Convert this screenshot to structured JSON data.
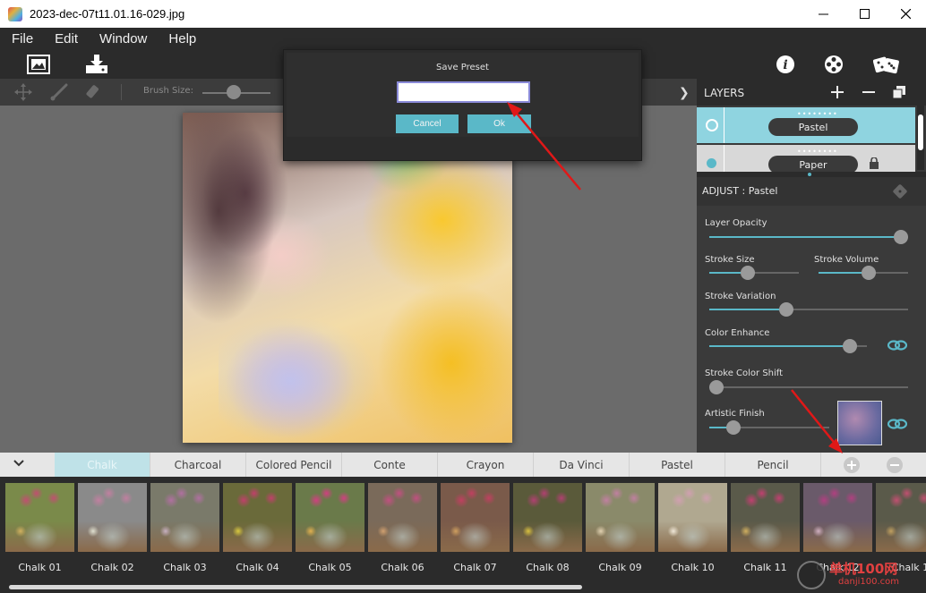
{
  "window": {
    "title": "2023-dec-07t11.01.16-029.jpg"
  },
  "menu": [
    "File",
    "Edit",
    "Window",
    "Help"
  ],
  "subtoolbar": {
    "brush_label": "Brush Size:",
    "brush_size": 0.45
  },
  "dialog": {
    "title": "Save Preset",
    "input_value": "",
    "cancel_label": "Cancel",
    "ok_label": "Ok"
  },
  "layers": {
    "title": "LAYERS",
    "items": [
      {
        "name": "Pastel",
        "selected": true
      },
      {
        "name": "Paper",
        "selected": false
      }
    ]
  },
  "adjust": {
    "title": "ADJUST : Pastel",
    "sliders": {
      "layer_opacity": {
        "label": "Layer Opacity",
        "value": 1.0
      },
      "stroke_size": {
        "label": "Stroke Size",
        "value": 0.42
      },
      "stroke_volume": {
        "label": "Stroke Volume",
        "value": 0.57
      },
      "stroke_variation": {
        "label": "Stroke Variation",
        "value": 0.38
      },
      "color_enhance": {
        "label": "Color Enhance",
        "value": 0.93
      },
      "stroke_color_shift": {
        "label": "Stroke Color Shift",
        "value": 0.0
      },
      "artistic_finish": {
        "label": "Artistic Finish",
        "value": 0.16
      }
    }
  },
  "preset_tabs": [
    "Chalk",
    "Charcoal",
    "Colored Pencil",
    "Conte",
    "Crayon",
    "Da Vinci",
    "Pastel",
    "Pencil"
  ],
  "active_tab": "Chalk",
  "presets": [
    "Chalk 01",
    "Chalk 02",
    "Chalk 03",
    "Chalk 04",
    "Chalk 05",
    "Chalk 06",
    "Chalk 07",
    "Chalk 08",
    "Chalk 09",
    "Chalk 10",
    "Chalk 11",
    "Chalk 12",
    "Chalk 1"
  ],
  "watermark": {
    "text": "单机100网",
    "sub": "danji100.com"
  },
  "colors": {
    "accent": "#5ab8c8",
    "panel_dark": "#2b2b2b",
    "tab_active": "#bfe2e8"
  }
}
